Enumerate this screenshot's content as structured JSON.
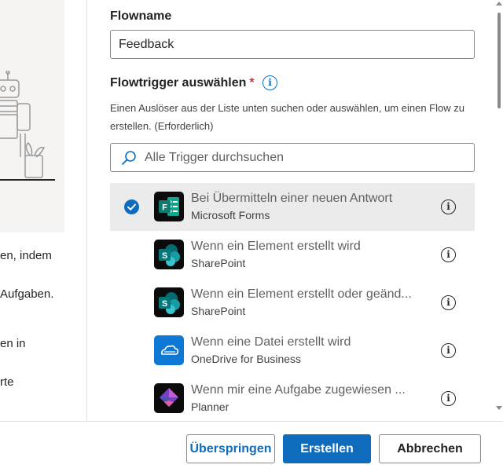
{
  "left_panel": {
    "text_lines": [
      "en, indem",
      "Aufgaben.",
      "en in",
      "rte"
    ]
  },
  "form": {
    "flowname_label": "Flowname",
    "flowname_value": "Feedback",
    "trigger_label": "Flowtrigger auswählen",
    "required_mark": "*",
    "description": "Einen Auslöser aus der Liste unten suchen oder auswählen, um einen Flow zu erstellen. (Erforderlich)",
    "search_placeholder": "Alle Trigger durchsuchen",
    "info_glyph": "i"
  },
  "triggers": [
    {
      "title": "Bei Übermitteln einer neuen Antwort",
      "connector": "Microsoft Forms",
      "icon": "microsoft-forms-icon",
      "color": "#0f7b6c",
      "selected": true
    },
    {
      "title": "Wenn ein Element erstellt wird",
      "connector": "SharePoint",
      "icon": "sharepoint-icon",
      "color": "#036c70",
      "selected": false
    },
    {
      "title": "Wenn ein Element erstellt oder geänd...",
      "connector": "SharePoint",
      "icon": "sharepoint-icon",
      "color": "#036c70",
      "selected": false
    },
    {
      "title": "Wenn eine Datei erstellt wird",
      "connector": "OneDrive for Business",
      "icon": "onedrive-icon",
      "color": "#0f78d4",
      "selected": false
    },
    {
      "title": "Wenn mir eine Aufgabe zugewiesen ...",
      "connector": "Planner",
      "icon": "planner-icon",
      "color": "#7b3fc4",
      "selected": false
    }
  ],
  "footer": {
    "skip_label": "Überspringen",
    "create_label": "Erstellen",
    "cancel_label": "Abbrechen"
  },
  "colors": {
    "accent": "#0f6cbd",
    "required": "#c4314b",
    "selected_row": "#ebebeb"
  }
}
